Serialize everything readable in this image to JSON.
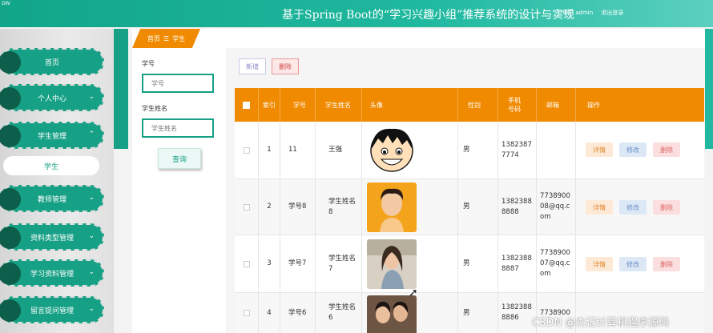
{
  "header": {
    "logo": "DW",
    "title": "基于Spring Boot的“学习兴趣小组”推荐系统的设计与实现",
    "role": "管理员 admin",
    "logout": "退出登录"
  },
  "sidebar": {
    "items": [
      {
        "label": "首页",
        "chev": ""
      },
      {
        "label": "个人中心",
        "chev": "⌄"
      },
      {
        "label": "学生管理",
        "chev": "⌃"
      },
      {
        "label": "教师管理",
        "chev": "⌄"
      },
      {
        "label": "资料类型管理",
        "chev": "⌄"
      },
      {
        "label": "学习资料管理",
        "chev": "⌄"
      },
      {
        "label": "留言提问管理",
        "chev": "⌄"
      }
    ],
    "subitem": "学生"
  },
  "breadcrumb": {
    "home": "首页",
    "sep": "☰",
    "current": "学生"
  },
  "search": {
    "label1": "学号",
    "placeholder1": "学号",
    "label2": "学生姓名",
    "placeholder2": "学生姓名",
    "button": "查询"
  },
  "toolbar": {
    "add": "新增",
    "delete": "删除"
  },
  "table": {
    "headers": [
      "",
      "索引",
      "学号",
      "学生姓名",
      "头像",
      "性别",
      "手机号码",
      "邮箱",
      "操作"
    ],
    "rows": [
      {
        "idx": "1",
        "no": "11",
        "name": "王强",
        "gender": "男",
        "phone": "13823877774",
        "email": ""
      },
      {
        "idx": "2",
        "no": "学号8",
        "name": "学生姓名8",
        "gender": "男",
        "phone": "13823888888",
        "email": "773890008@qq.com"
      },
      {
        "idx": "3",
        "no": "学号7",
        "name": "学生姓名7",
        "gender": "男",
        "phone": "13823888887",
        "email": "773890007@qq.com"
      },
      {
        "idx": "4",
        "no": "学号6",
        "name": "学生姓名6",
        "gender": "男",
        "phone": "13823888886",
        "email": "7738900"
      }
    ],
    "actions": {
      "detail": "详情",
      "edit": "修改",
      "delete": "删除"
    }
  },
  "watermark": "CSDN @杰记计算机程序源码",
  "colors": {
    "teal": "#16a085",
    "orange": "#f08a00"
  }
}
